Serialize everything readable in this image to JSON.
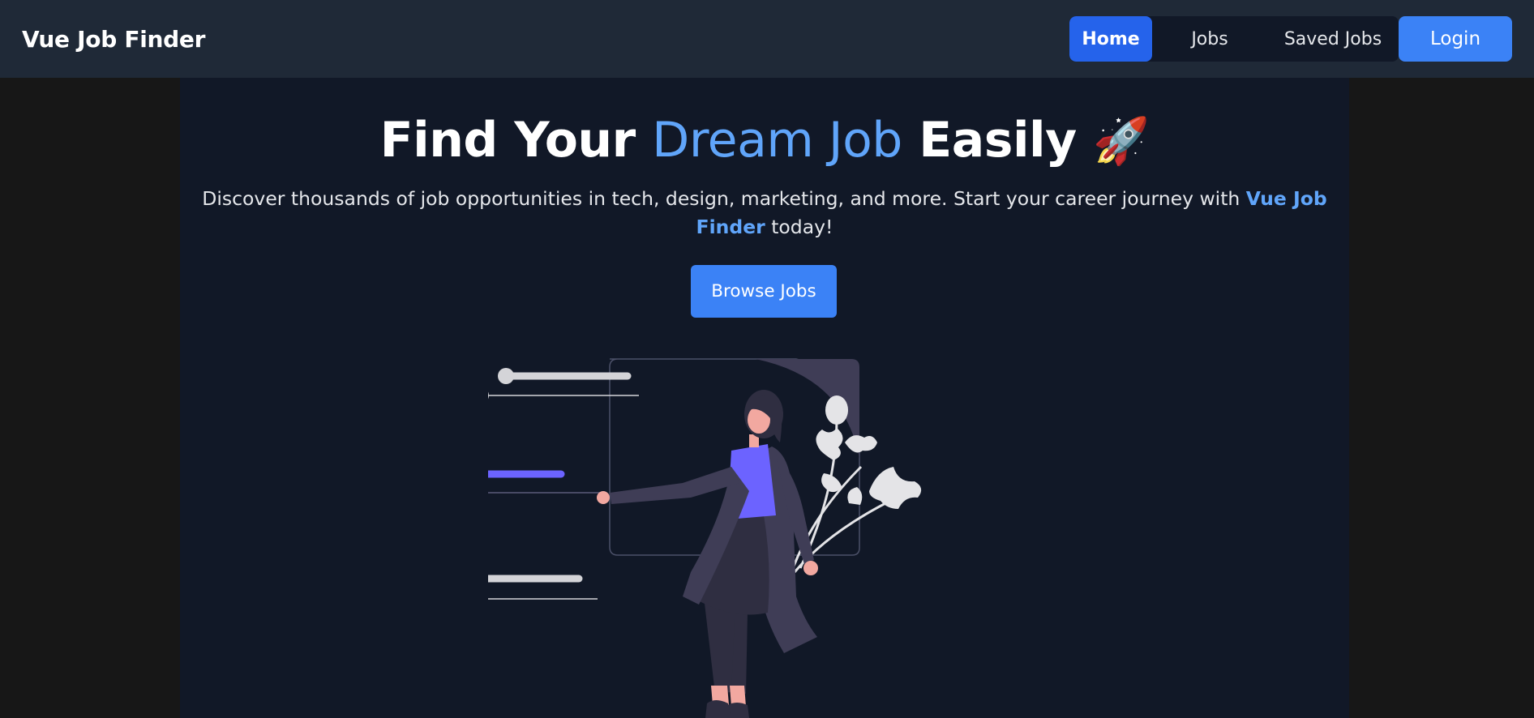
{
  "navbar": {
    "brand": "Vue Job Finder",
    "links": [
      {
        "label": "Home",
        "active": true
      },
      {
        "label": "Jobs",
        "active": false
      },
      {
        "label": "Saved Jobs",
        "active": false
      }
    ],
    "login_label": "Login"
  },
  "hero": {
    "title_part1": "Find Your ",
    "title_accent": "Dream Job",
    "title_part2": " Easily ",
    "title_emoji": "🚀",
    "subtitle_before": "Discover thousands of job opportunities in tech, design, marketing, and more. Start your career journey with ",
    "subtitle_brand": "Vue Job Finder",
    "subtitle_after": " today!",
    "cta_label": "Browse Jobs"
  },
  "illustration": {
    "icon": "woman-selecting-options-illustration"
  },
  "colors": {
    "nav_bg": "#1f2937",
    "page_bg": "#111827",
    "outer_bg": "#171717",
    "accent": "#3b82f6",
    "accent_light": "#60a5fa",
    "active_nav": "#2563eb",
    "illustration_purple": "#6c63ff"
  }
}
